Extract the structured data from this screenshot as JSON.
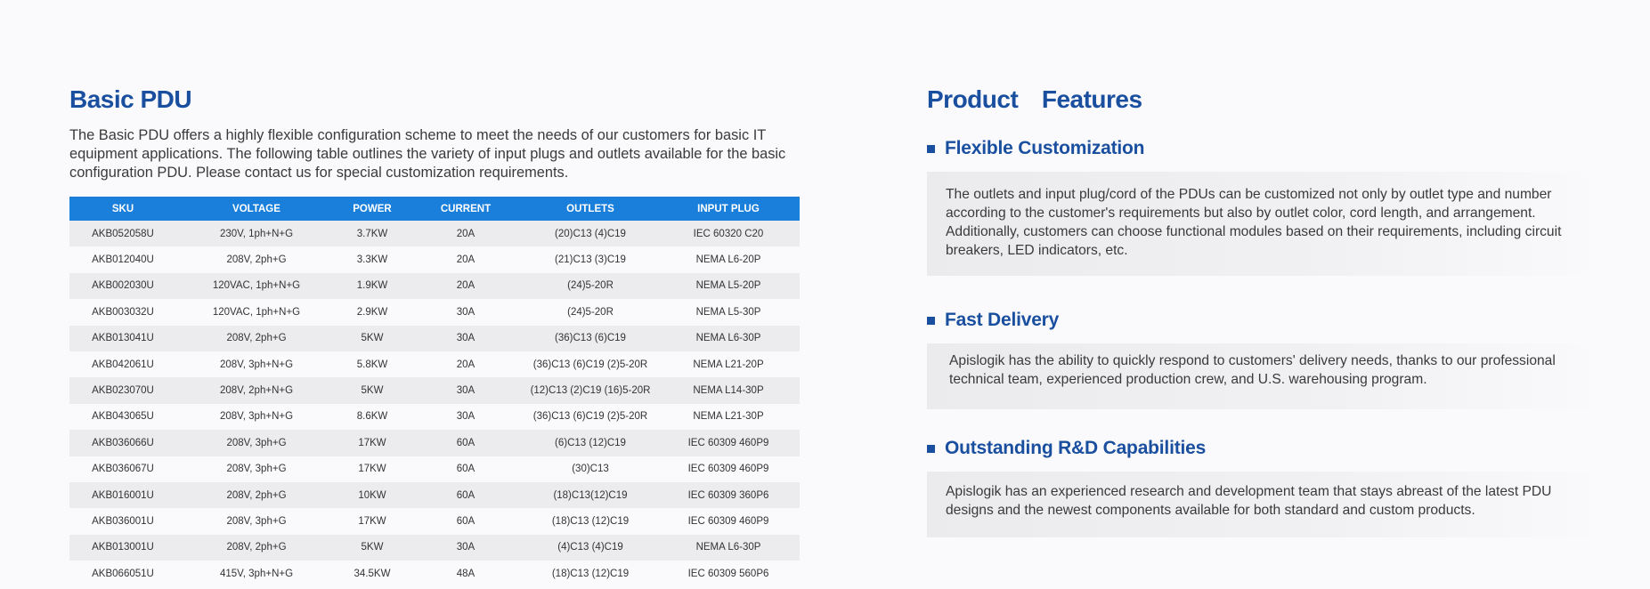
{
  "basic_pdu": {
    "title": "Basic PDU",
    "description": "The Basic PDU offers a highly flexible configuration scheme to meet the needs of our customers for basic IT equipment applications. The following table outlines the variety of input plugs and outlets available for the basic configuration PDU. Please contact us for special customization requirements.",
    "table": {
      "headers": [
        "SKU",
        "VOLTAGE",
        "POWER",
        "CURRENT",
        "OUTLETS",
        "INPUT PLUG"
      ],
      "rows": [
        [
          "AKB052058U",
          "230V, 1ph+N+G",
          "3.7KW",
          "20A",
          "(20)C13 (4)C19",
          "IEC 60320 C20"
        ],
        [
          "AKB012040U",
          "208V, 2ph+G",
          "3.3KW",
          "20A",
          "(21)C13 (3)C19",
          "NEMA L6-20P"
        ],
        [
          "AKB002030U",
          "120VAC, 1ph+N+G",
          "1.9KW",
          "20A",
          "(24)5-20R",
          "NEMA L5-20P"
        ],
        [
          "AKB003032U",
          "120VAC, 1ph+N+G",
          "2.9KW",
          "30A",
          "(24)5-20R",
          "NEMA L5-30P"
        ],
        [
          "AKB013041U",
          "208V, 2ph+G",
          "5KW",
          "30A",
          "(36)C13 (6)C19",
          "NEMA L6-30P"
        ],
        [
          "AKB042061U",
          "208V, 3ph+N+G",
          "5.8KW",
          "20A",
          "(36)C13 (6)C19 (2)5-20R",
          "NEMA L21-20P"
        ],
        [
          "AKB023070U",
          "208V, 2ph+N+G",
          "5KW",
          "30A",
          "(12)C13 (2)C19 (16)5-20R",
          "NEMA L14-30P"
        ],
        [
          "AKB043065U",
          "208V, 3ph+N+G",
          "8.6KW",
          "30A",
          "(36)C13 (6)C19 (2)5-20R",
          "NEMA L21-30P"
        ],
        [
          "AKB036066U",
          "208V, 3ph+G",
          "17KW",
          "60A",
          "(6)C13 (12)C19",
          "IEC 60309 460P9"
        ],
        [
          "AKB036067U",
          "208V, 3ph+G",
          "17KW",
          "60A",
          "(30)C13",
          "IEC 60309 460P9"
        ],
        [
          "AKB016001U",
          "208V, 2ph+G",
          "10KW",
          "60A",
          "(18)C13(12)C19",
          "IEC 60309 360P6"
        ],
        [
          "AKB036001U",
          "208V, 3ph+G",
          "17KW",
          "60A",
          "(18)C13 (12)C19",
          "IEC 60309 460P9"
        ],
        [
          "AKB013001U",
          "208V, 2ph+G",
          "5KW",
          "30A",
          "(4)C13 (4)C19",
          "NEMA L6-30P"
        ],
        [
          "AKB066051U",
          "415V, 3ph+N+G",
          "34.5KW",
          "48A",
          "(18)C13 (12)C19",
          "IEC 60309 560P6"
        ]
      ]
    }
  },
  "product_features": {
    "title": "Product  Features",
    "items": [
      {
        "heading": "Flexible Customization",
        "text": "The outlets and input plug/cord of the PDUs can be customized not only by outlet type and number according to the customer's requirements but also by outlet color, cord length, and arrangement. Additionally, customers can choose functional modules based on their requirements, including circuit breakers, LED indicators, etc."
      },
      {
        "heading": "Fast Delivery",
        "text": "Apislogik has the ability to quickly respond to customers' delivery needs, thanks to our professional technical team, experienced production crew, and U.S. warehousing program."
      },
      {
        "heading": "Outstanding R&D Capabilities",
        "text": "Apislogik has an experienced research and development team that stays abreast of the latest PDU designs and the newest components available for both standard and custom products."
      }
    ]
  },
  "colors": {
    "heading_blue": "#1a4fa0",
    "table_header_blue": "#1a7fdb",
    "row_stripe": "#ececee"
  }
}
